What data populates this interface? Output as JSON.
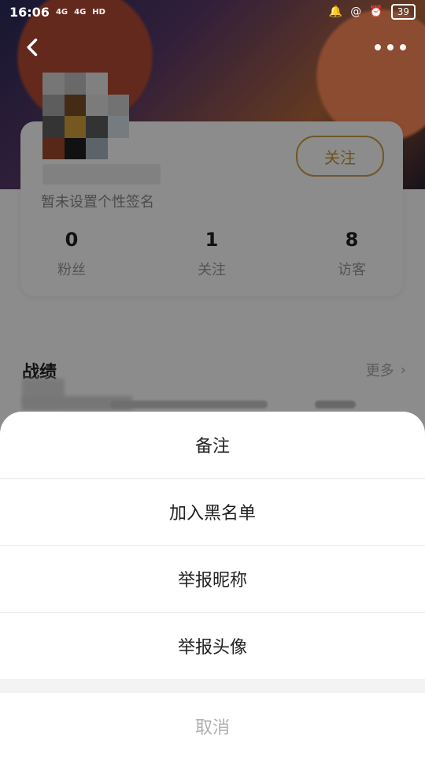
{
  "status_bar": {
    "time": "16:06",
    "signal_1": "4G",
    "signal_2": "4G",
    "hd": "HD",
    "battery": "39"
  },
  "profile": {
    "follow_button": "关注",
    "signature": "暂未设置个性签名",
    "stats": [
      {
        "value": "0",
        "label": "粉丝"
      },
      {
        "value": "1",
        "label": "关注"
      },
      {
        "value": "8",
        "label": "访客"
      }
    ]
  },
  "record_section": {
    "title": "战绩",
    "more": "更多"
  },
  "sheet": {
    "items": [
      "备注",
      "加入黑名单",
      "举报昵称",
      "举报头像"
    ],
    "cancel": "取消"
  },
  "colors": {
    "accent": "#c8963e",
    "overlay": "rgba(0,0,0,0.45)"
  },
  "icons": {
    "back": "chevron-left-icon",
    "more": "more-dots-icon",
    "chevron_right": "chevron-right-icon"
  }
}
